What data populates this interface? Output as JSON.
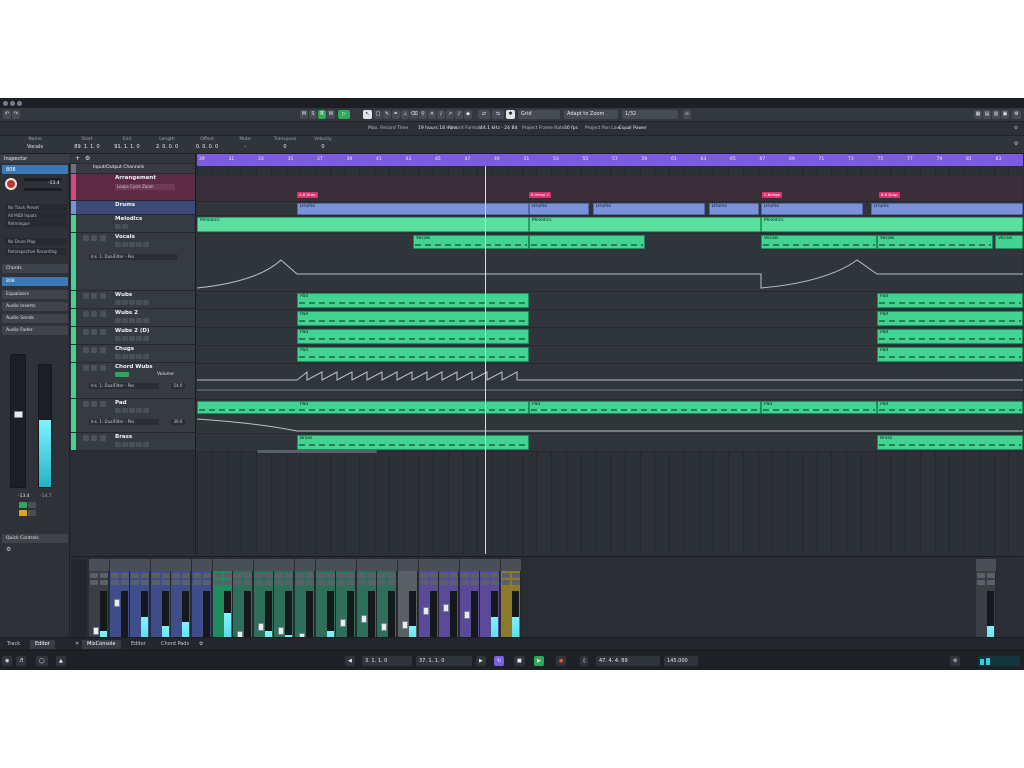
{
  "toolbar": {
    "undo": "↶",
    "redo": "↷",
    "mode_m": "M",
    "mode_s": "S",
    "mode_r": "R",
    "mode_w": "W",
    "grid_label": "Grid",
    "zoom_label": "Adapt to Zoom",
    "quantize": "1/32"
  },
  "status_line": {
    "record_time": "Max. Record Time",
    "record_time_val": "19 hours 18 mins",
    "record_format": "Record Format",
    "record_format_val": "44.1 kHz - 24 Bit",
    "frame_rate": "Project Frame Rate",
    "frame_rate_val": "30 fps",
    "pan_law": "Project Pan Law",
    "pan_law_val": "Equal Power"
  },
  "infobar": {
    "name_label": "Name",
    "name_value": "Vocals",
    "start_label": "Start",
    "start_value": "89. 1. 1. 0",
    "end_label": "End",
    "end_value": "91. 1. 1. 0",
    "length_label": "Length",
    "length_value": "2. 0. 0. 0",
    "offset_label": "Offset",
    "offset_value": "0. 0. 0. 0",
    "mute_label": "Mute",
    "mute_value": "-",
    "transpose_label": "Transpose",
    "transpose_value": "0",
    "velocity_label": "Velocity",
    "velocity_value": "0"
  },
  "inspector": {
    "title": "Inspector",
    "track": "808",
    "vol_value": "-13.4",
    "row1": "No Track Preset",
    "row2": "All MIDI Inputs",
    "row3": "Retrologue",
    "row4": "No Drum Map",
    "row5": "Retrospective Recording",
    "chords": "Chords",
    "channel": "808",
    "equalizers": "Equalizers",
    "inserts": "Audio Inserts",
    "sends": "Audio Sends",
    "fader": "Audio Fader",
    "fader_val_l": "-13.4",
    "fader_val_r": "-14.7",
    "quick_controls": "Quick Controls"
  },
  "tracklist": {
    "folder_head": "Input/Output Channels",
    "tracks": [
      {
        "name": "Arrangement",
        "sub": "Loops  Cycle  Zoom"
      },
      {
        "name": "Drums",
        "sub": ""
      },
      {
        "name": "Melodics",
        "sub": ""
      },
      {
        "name": "Vocals",
        "sub": "Ins. 1: DualFilter - Pos"
      },
      {
        "name": "Wubs",
        "sub": ""
      },
      {
        "name": "Wubs 2",
        "sub": ""
      },
      {
        "name": "Wubs 2 (D)",
        "sub": ""
      },
      {
        "name": "Chugs",
        "sub": ""
      },
      {
        "name": "Chord Wubs",
        "sub": "Ins. 1: DualFilter - Pos"
      },
      {
        "name": "Pad",
        "sub": "Ins. 1: DualFilter - Pos"
      },
      {
        "name": "Brass",
        "sub": ""
      }
    ],
    "volume": "Volume",
    "vol_num": "54.0",
    "num2": "39.0"
  },
  "ruler": {
    "bars": [
      "29",
      "31",
      "33",
      "35",
      "37",
      "39",
      "41",
      "43",
      "45",
      "47",
      "49",
      "51",
      "53",
      "55",
      "57",
      "59",
      "61",
      "63",
      "65",
      "67",
      "69",
      "71",
      "73",
      "75",
      "77",
      "79",
      "81",
      "83"
    ]
  },
  "parts": {
    "drums": "Drums",
    "melodics": "Melodics",
    "vocals": "Vocals",
    "pad": "Pad",
    "brass": "Brass",
    "markers": [
      "A.6 Drop",
      "B.Verse 2",
      "C.Bridge",
      "B.6 Drop"
    ]
  },
  "mixer": {
    "strips": [
      {
        "num": "",
        "name": "Stereo In",
        "val": "-6.89"
      },
      {
        "num": "28",
        "name": "Synth_Wave_Pu 16",
        "val": "-30.5"
      },
      {
        "num": "29",
        "name": "VK_4_Crash2_x",
        "val": "0.00"
      },
      {
        "num": "30",
        "name": "MHH_1_Crash",
        "val": "0.00"
      },
      {
        "num": "31",
        "name": "FC84_CK_1_Cn",
        "val": "0.00"
      },
      {
        "num": "32",
        "name": "Cymbal Buss",
        "val": "-26.0"
      },
      {
        "num": "33",
        "name": "Drums Buss",
        "val": "0.00"
      },
      {
        "num": "34",
        "name": "Vocals",
        "val": "-16.0"
      },
      {
        "num": "35",
        "name": "Wubs",
        "val": "-12.4"
      },
      {
        "num": "36",
        "name": "Wubs 2",
        "val": "-11.1"
      },
      {
        "num": "37",
        "name": "Wubs 2 (D)",
        "val": "-7.03"
      },
      {
        "num": "38",
        "name": "Chugs",
        "val": "-2.82"
      },
      {
        "num": "39",
        "name": "Chord Wubs",
        "val": "-22.2"
      },
      {
        "num": "40",
        "name": "Pad",
        "val": "-13.9"
      },
      {
        "num": "41",
        "name": "Brass",
        "val": "-11.2"
      },
      {
        "num": "42",
        "name": "808",
        "val": "-13.4"
      },
      {
        "num": "43",
        "name": "Percussive Hit 25 - C.AIM",
        "val": "-25.8"
      },
      {
        "num": "44",
        "name": "Percussive Hit 05 AIM",
        "val": "-34.1"
      },
      {
        "num": "45",
        "name": "Percussive Hit 10 AIM",
        "val": "-20.0"
      },
      {
        "num": "46",
        "name": "Cinematics Buss",
        "val": "0.00"
      },
      {
        "num": "47",
        "name": "Sidechain Buss",
        "val": "0.00"
      },
      {
        "num": "",
        "name": "Stereo Out",
        "val": "0.00"
      }
    ]
  },
  "tabs": {
    "track": "Track",
    "editor": "Editor",
    "mixconsole": "MixConsole",
    "editor2": "Editor",
    "chordpads": "Chord Pads"
  },
  "transport": {
    "left_locator": "3. 1. 1. 0",
    "right_locator": "37. 1. 1. 0",
    "position": "47. 4. 4. 89",
    "tempo": "145.000"
  }
}
